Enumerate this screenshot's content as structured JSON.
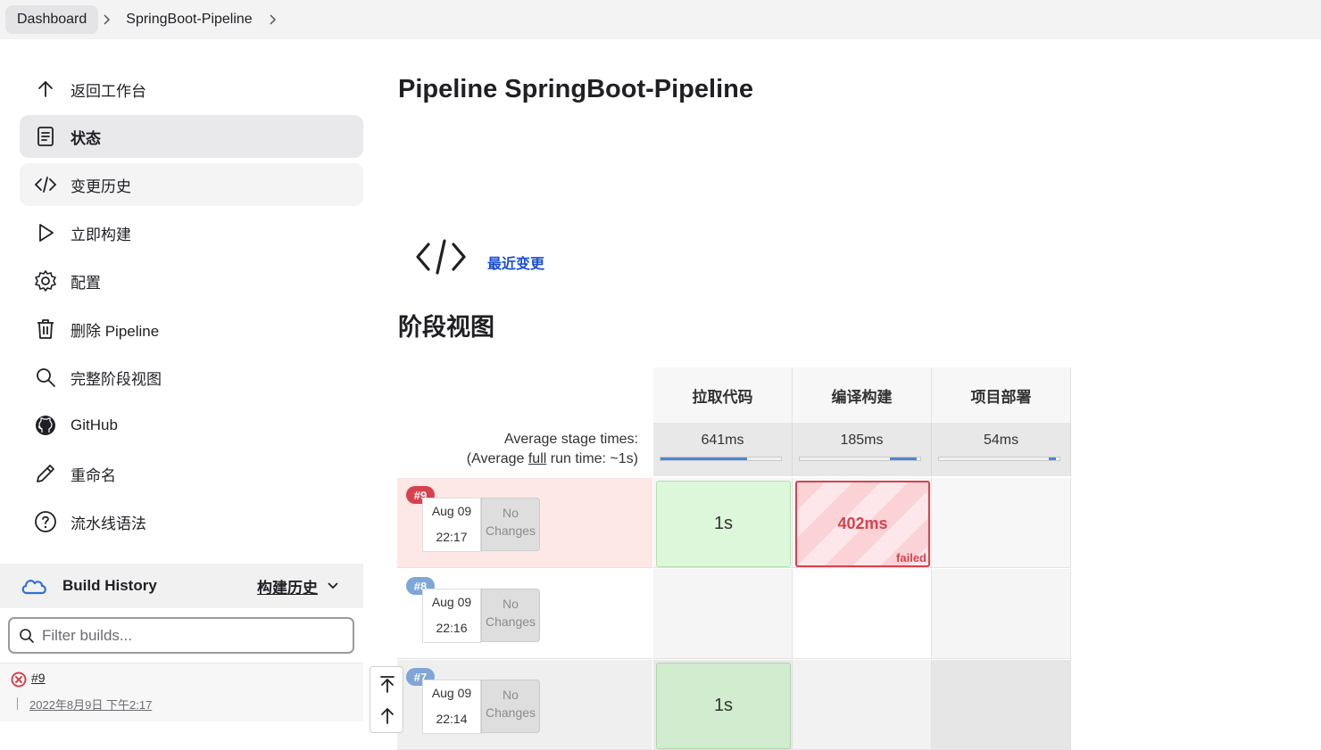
{
  "breadcrumb": {
    "items": [
      "Dashboard",
      "SpringBoot-Pipeline"
    ]
  },
  "sidebar": {
    "items": [
      {
        "label": "返回工作台",
        "icon": "arrow-up-icon"
      },
      {
        "label": "状态",
        "icon": "document-icon"
      },
      {
        "label": "变更历史",
        "icon": "code-icon"
      },
      {
        "label": "立即构建",
        "icon": "play-icon"
      },
      {
        "label": "配置",
        "icon": "gear-icon"
      },
      {
        "label": "删除 Pipeline",
        "icon": "trash-icon"
      },
      {
        "label": "完整阶段视图",
        "icon": "search-icon"
      },
      {
        "label": "GitHub",
        "icon": "github-icon"
      },
      {
        "label": "重命名",
        "icon": "pencil-icon"
      },
      {
        "label": "流水线语法",
        "icon": "help-icon"
      }
    ]
  },
  "build_history": {
    "title": "Build History",
    "link": "构建历史",
    "filter_placeholder": "Filter builds...",
    "entries": [
      {
        "number": "#9",
        "date": "2022年8月9日 下午2:17",
        "status": "failed"
      }
    ]
  },
  "main": {
    "title": "Pipeline SpringBoot-Pipeline",
    "recent_changes": "最近变更",
    "stage_view_title": "阶段视图"
  },
  "stage_view": {
    "stages": [
      "拉取代码",
      "编译构建",
      "项目部署"
    ],
    "avg_label_1": "Average stage times:",
    "avg_label_2_prefix": "(Average ",
    "avg_label_2_link": "full",
    "avg_label_2_suffix": " run time: ~1s)",
    "avg_times": [
      "641ms",
      "185ms",
      "54ms"
    ],
    "avg_progress": [
      0.72,
      0.22,
      0.06
    ],
    "runs": [
      {
        "badge": "#9",
        "date": "Aug 09",
        "time": "22:17",
        "changes": [
          "No",
          "Changes"
        ],
        "cells": [
          "1s",
          "402ms",
          ""
        ],
        "fail_tag": "failed"
      },
      {
        "badge": "#8",
        "date": "Aug 09",
        "time": "22:16",
        "changes": [
          "No",
          "Changes"
        ],
        "cells": [
          "",
          "",
          ""
        ]
      },
      {
        "badge": "#7",
        "date": "Aug 09",
        "time": "22:14",
        "changes": [
          "No",
          "Changes"
        ],
        "cells": [
          "1s",
          "",
          ""
        ]
      }
    ]
  },
  "colors": {
    "link": "#1a4fd1",
    "failed": "#d9404e",
    "success_bg": "#dcf7d9",
    "badge_failed": "#d9404e",
    "badge_other": "#7ea6d6"
  }
}
